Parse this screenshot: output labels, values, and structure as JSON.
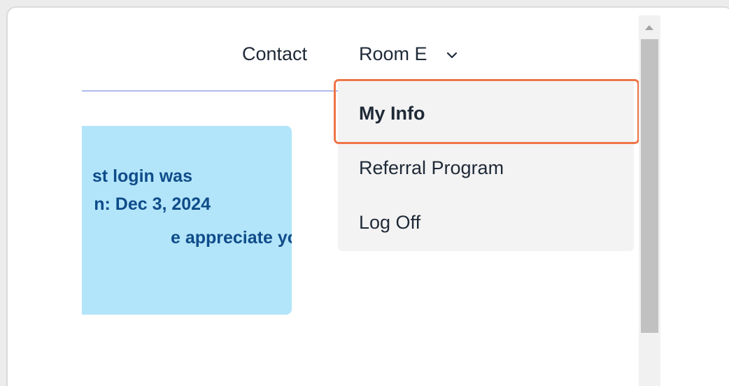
{
  "nav": {
    "contact_label": "Contact",
    "account_label": "Room E",
    "account_icon": "chevron-down-icon"
  },
  "alert": {
    "line1": "st login was",
    "line2": "n: Dec 3, 2024",
    "line3": "e appreciate your"
  },
  "dropdown": {
    "items": [
      {
        "label": "My Info"
      },
      {
        "label": "Referral Program"
      },
      {
        "label": "Log Off"
      }
    ]
  },
  "colors": {
    "highlight": "#ee7648",
    "alert_bg": "#b3e5fa",
    "alert_text": "#0f4c8a",
    "dropdown_bg": "#f3f3f3"
  }
}
